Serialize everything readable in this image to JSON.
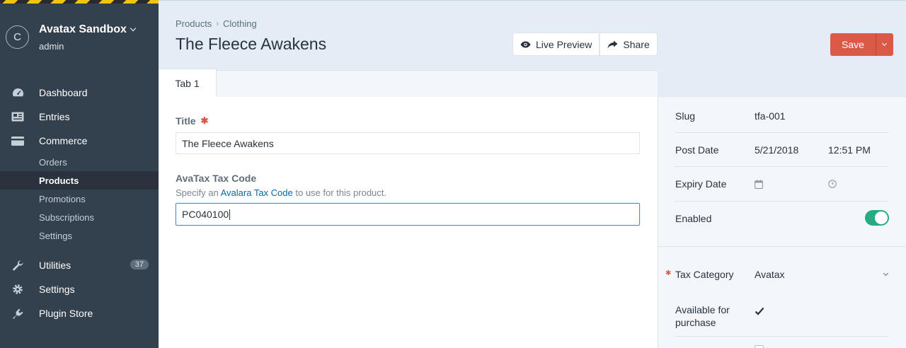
{
  "sidebar": {
    "site_logo_letter": "C",
    "site_name": "Avatax Sandbox",
    "user": "admin",
    "items": [
      {
        "label": "Dashboard"
      },
      {
        "label": "Entries"
      },
      {
        "label": "Commerce"
      },
      {
        "label": "Utilities",
        "badge": "37"
      },
      {
        "label": "Settings"
      },
      {
        "label": "Plugin Store"
      }
    ],
    "commerce_subitems": [
      {
        "label": "Orders"
      },
      {
        "label": "Products"
      },
      {
        "label": "Promotions"
      },
      {
        "label": "Subscriptions"
      },
      {
        "label": "Settings"
      }
    ]
  },
  "header": {
    "breadcrumbs": [
      "Products",
      "Clothing"
    ],
    "title": "The Fleece Awakens",
    "live_preview_label": "Live Preview",
    "share_label": "Share",
    "save_label": "Save"
  },
  "tabs": [
    {
      "label": "Tab 1"
    }
  ],
  "form": {
    "title_label": "Title",
    "title_value": "The Fleece Awakens",
    "taxcode_label": "AvaTax Tax Code",
    "taxcode_instr_pre": "Specify an",
    "taxcode_instr_link": "Avalara Tax Code",
    "taxcode_instr_post": "to use for this product.",
    "taxcode_value": "PC040100"
  },
  "meta": {
    "slug_label": "Slug",
    "slug_value": "tfa-001",
    "postdate_label": "Post Date",
    "postdate_date": "5/21/2018",
    "postdate_time": "12:51 PM",
    "expiry_label": "Expiry Date",
    "enabled_label": "Enabled",
    "enabled": true,
    "taxcat_label": "Tax Category",
    "taxcat_value": "Avatax",
    "available_label": "Available for purchase",
    "available": true
  },
  "colors": {
    "accent": "#da5a47",
    "sidebar": "#33404d",
    "toggle_on": "#27ab83",
    "link": "#0b69a3"
  }
}
